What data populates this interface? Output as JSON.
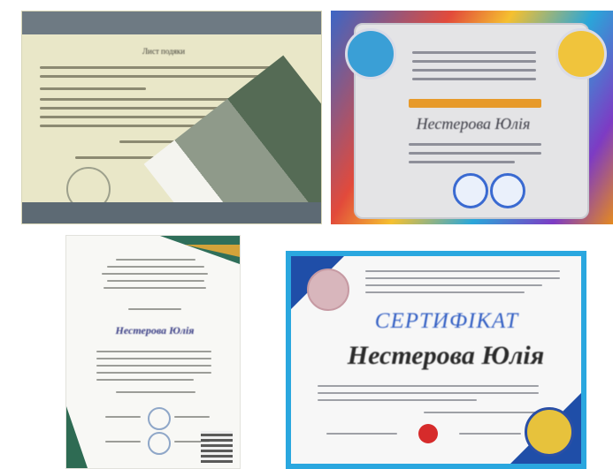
{
  "certificates": [
    {
      "id": "letter",
      "title_text": "Лист подяки"
    },
    {
      "id": "colorful",
      "name": "Нестерова Юлія"
    },
    {
      "id": "portrait",
      "name": "Нестерова Юлія"
    },
    {
      "id": "blue-frame",
      "heading": "СЕРТИФІКАТ",
      "name": "Нестерова Юлія"
    }
  ],
  "colors": {
    "cert1_background": "#e9e7c8",
    "cert2_gradient": [
      "#3b66c6",
      "#e24a3b",
      "#f5c030",
      "#2aa6d9",
      "#7d3bc4",
      "#e58a1f"
    ],
    "cert3_accent": "#2f6f5a",
    "cert4_frame": "#2aa7df",
    "cert4_heading": "#3460c4"
  }
}
